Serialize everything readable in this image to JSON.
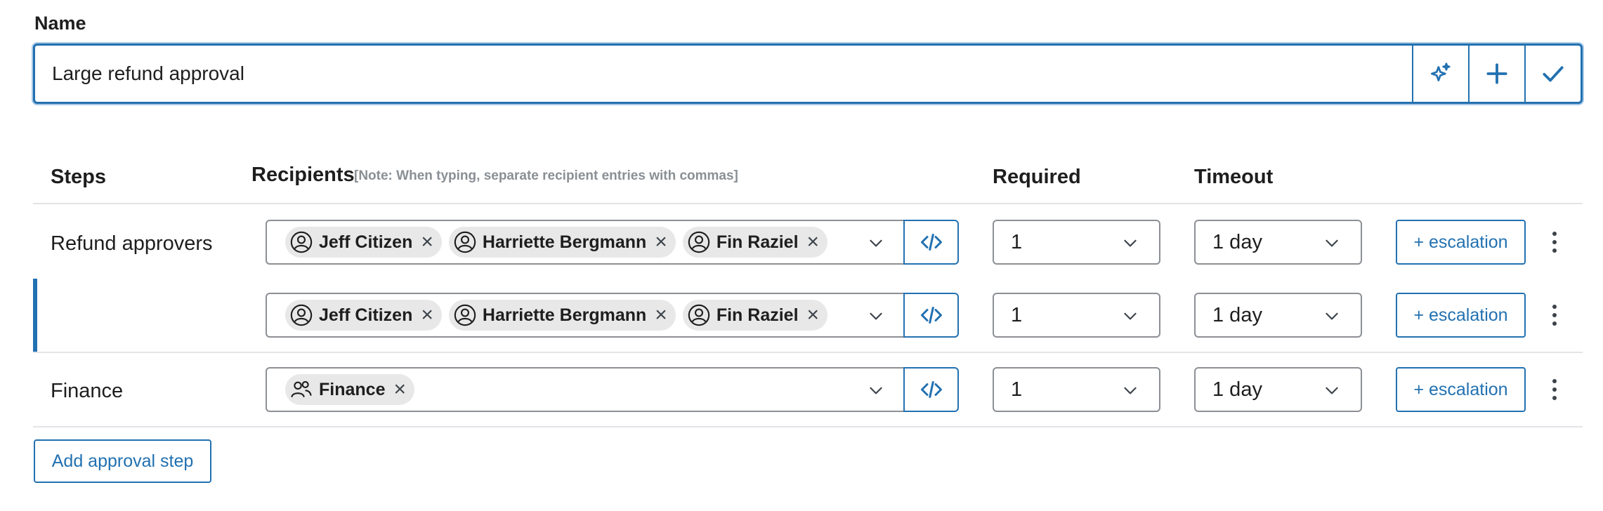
{
  "name_section": {
    "label": "Name",
    "value": "Large refund approval",
    "actions": [
      "sparkles-icon",
      "plus-icon",
      "check-icon"
    ]
  },
  "table": {
    "headers": {
      "steps": "Steps",
      "recipients": "Recipients",
      "recipients_note": "[Note: When typing, separate recipient entries with commas]",
      "required": "Required",
      "timeout": "Timeout"
    },
    "rows": [
      {
        "step": "Refund approvers",
        "recipients": [
          {
            "name": "Jeff Citizen",
            "icon": "user-circle-icon"
          },
          {
            "name": "Harriette Bergmann",
            "icon": "user-circle-icon"
          },
          {
            "name": "Fin Raziel",
            "icon": "user-circle-icon"
          }
        ],
        "required": "1",
        "timeout": "1 day",
        "escalation_label": "+ escalation"
      },
      {
        "step": "",
        "recipients": [
          {
            "name": "Jeff Citizen",
            "icon": "user-circle-icon"
          },
          {
            "name": "Harriette Bergmann",
            "icon": "user-circle-icon"
          },
          {
            "name": "Fin Raziel",
            "icon": "user-circle-icon"
          }
        ],
        "required": "1",
        "timeout": "1 day",
        "escalation_label": "+ escalation"
      },
      {
        "step": "Finance",
        "recipients": [
          {
            "name": "Finance",
            "icon": "group-icon"
          }
        ],
        "required": "1",
        "timeout": "1 day",
        "escalation_label": "+ escalation"
      }
    ]
  },
  "add_step_label": "Add approval step",
  "colors": {
    "accent": "#2271b1",
    "border": "#8c8f94",
    "chip_bg": "#e8e8e8",
    "note": "#8a8f94"
  }
}
